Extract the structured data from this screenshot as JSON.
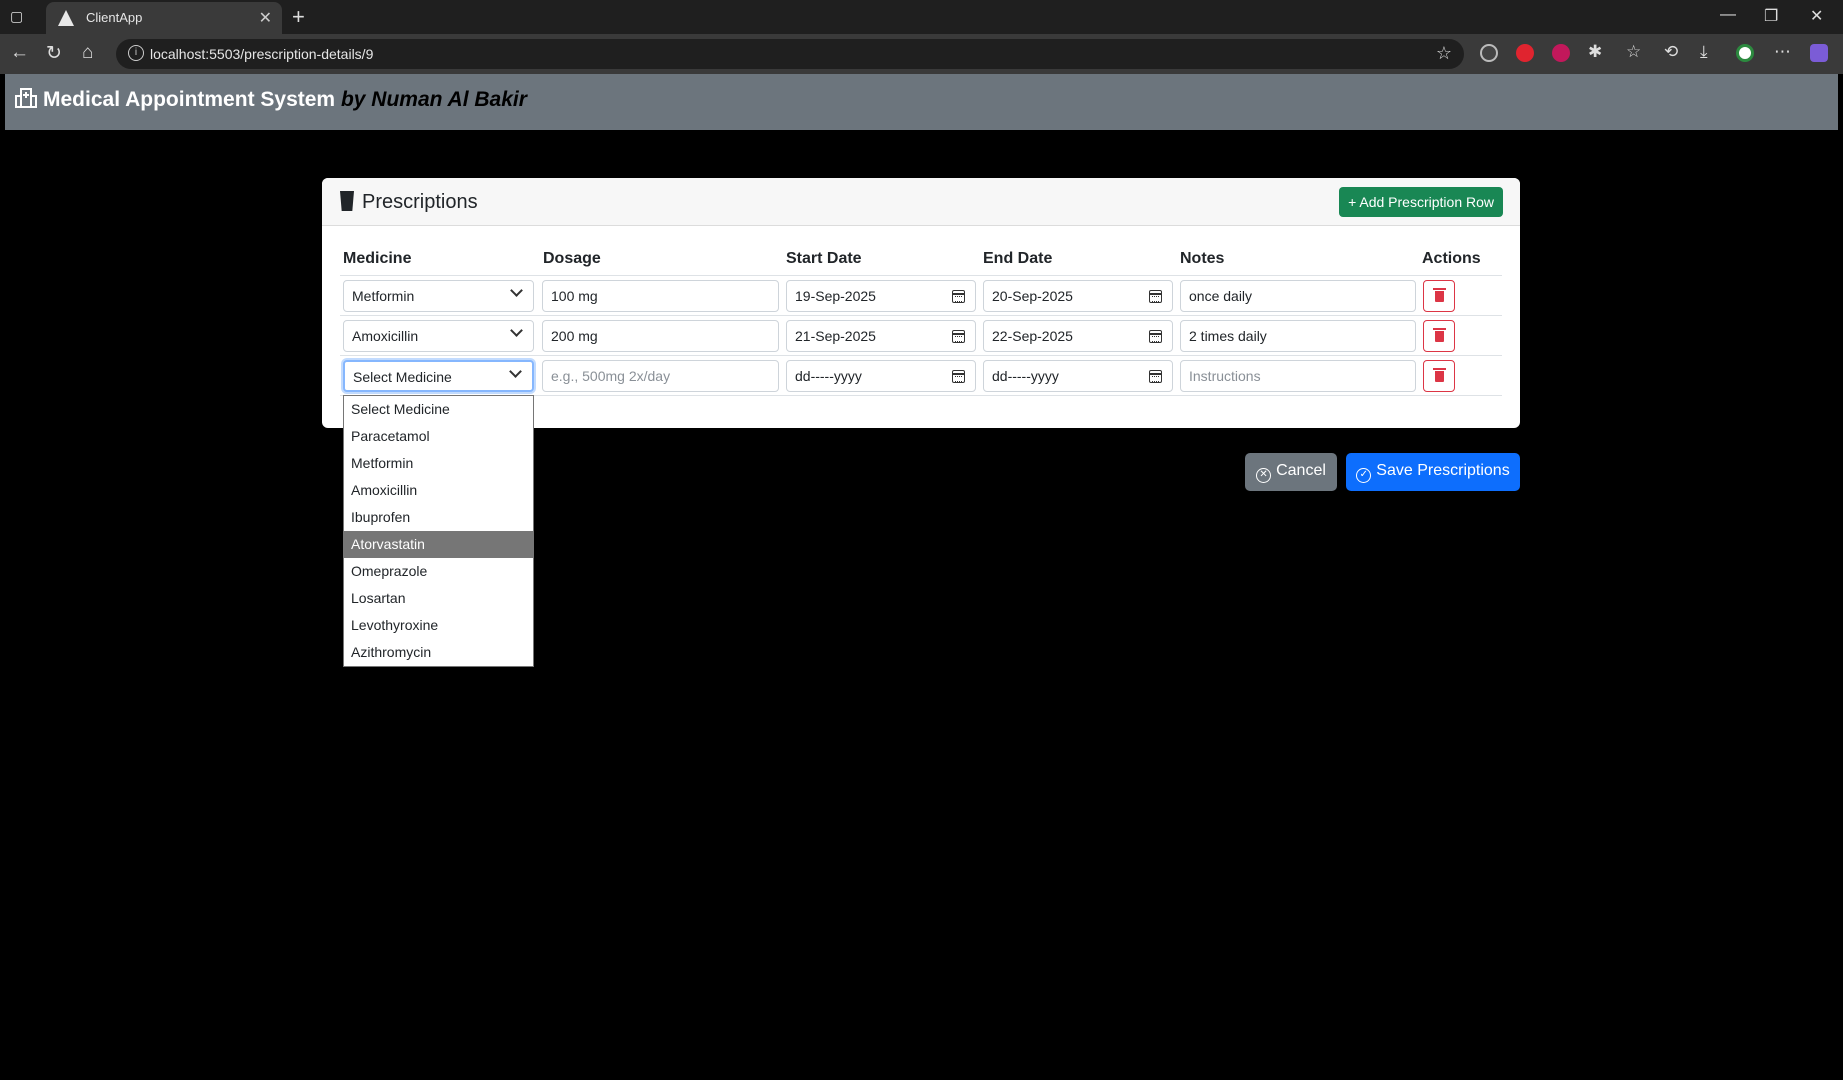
{
  "browser": {
    "tab_title": "ClientApp",
    "url": "localhost:5503/prescription-details/9"
  },
  "app": {
    "title": "Medical Appointment System",
    "author": "by Numan Al Bakir"
  },
  "card": {
    "title": "Prescriptions",
    "add_button": "+ Add Prescription Row"
  },
  "table": {
    "headers": [
      "Medicine",
      "Dosage",
      "Start Date",
      "End Date",
      "Notes",
      "Actions"
    ],
    "rows": [
      {
        "medicine": "Metformin",
        "dosage": "100 mg",
        "start": "19-Sep-2025",
        "end": "20-Sep-2025",
        "notes": "once daily"
      },
      {
        "medicine": "Amoxicillin",
        "dosage": "200 mg",
        "start": "21-Sep-2025",
        "end": "22-Sep-2025",
        "notes": "2 times daily"
      },
      {
        "medicine": "Select Medicine",
        "dosage": "",
        "start": "dd-----yyyy",
        "end": "dd-----yyyy",
        "notes": ""
      }
    ],
    "placeholders": {
      "dosage": "e.g., 500mg 2x/day",
      "notes": "Instructions"
    }
  },
  "dropdown": {
    "options": [
      "Select Medicine",
      "Paracetamol",
      "Metformin",
      "Amoxicillin",
      "Ibuprofen",
      "Atorvastatin",
      "Omeprazole",
      "Losartan",
      "Levothyroxine",
      "Azithromycin"
    ],
    "highlighted": "Atorvastatin"
  },
  "actions": {
    "cancel": "Cancel",
    "save": "Save Prescriptions"
  },
  "colors": {
    "header_bg": "#6c757d",
    "add_button": "#198754",
    "save_button": "#0d6efd",
    "delete": "#dc3545"
  }
}
